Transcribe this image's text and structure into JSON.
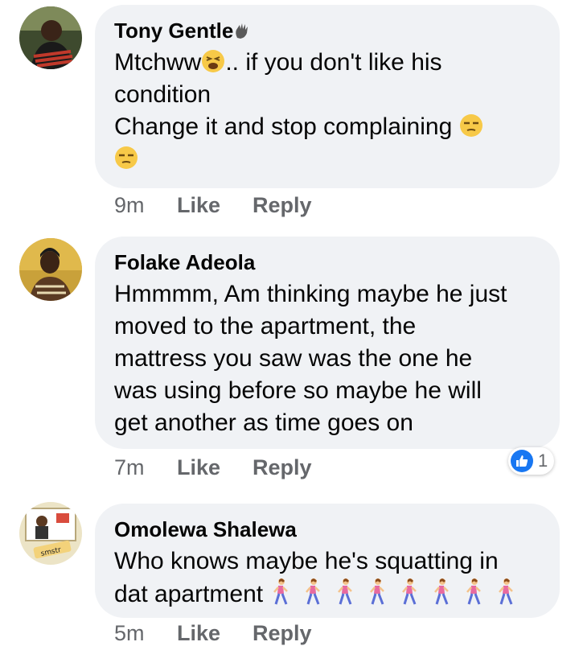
{
  "comments": [
    {
      "author": "Tony Gentle",
      "author_icon": "waving-hand-icon",
      "lines": [
        "Mtchww",
        ".. if you don't like his",
        "condition",
        "Change it and stop complaining"
      ],
      "time": "9m",
      "like_label": "Like",
      "reply_label": "Reply"
    },
    {
      "author": "Folake Adeola",
      "text": "Hmmmm, Am thinking maybe he just\nmoved to the apartment, the\nmattress you saw was the one he\nwas using before so maybe he will\nget another as time goes on",
      "time": "7m",
      "like_label": "Like",
      "reply_label": "Reply",
      "reaction_count": "1",
      "reaction_icon": "thumbs-up-icon"
    },
    {
      "author": "Omolewa Shalewa",
      "line1": "Who knows maybe he's squatting in",
      "line2": "dat apartment",
      "emoji_name": "woman-walking-icon",
      "emoji_count": 8,
      "time": "5m",
      "like_label": "Like",
      "reply_label": "Reply"
    }
  ],
  "colors": {
    "bubble": "#f0f2f5",
    "meta_text": "#65676b",
    "like_blue": "#1877f2"
  }
}
